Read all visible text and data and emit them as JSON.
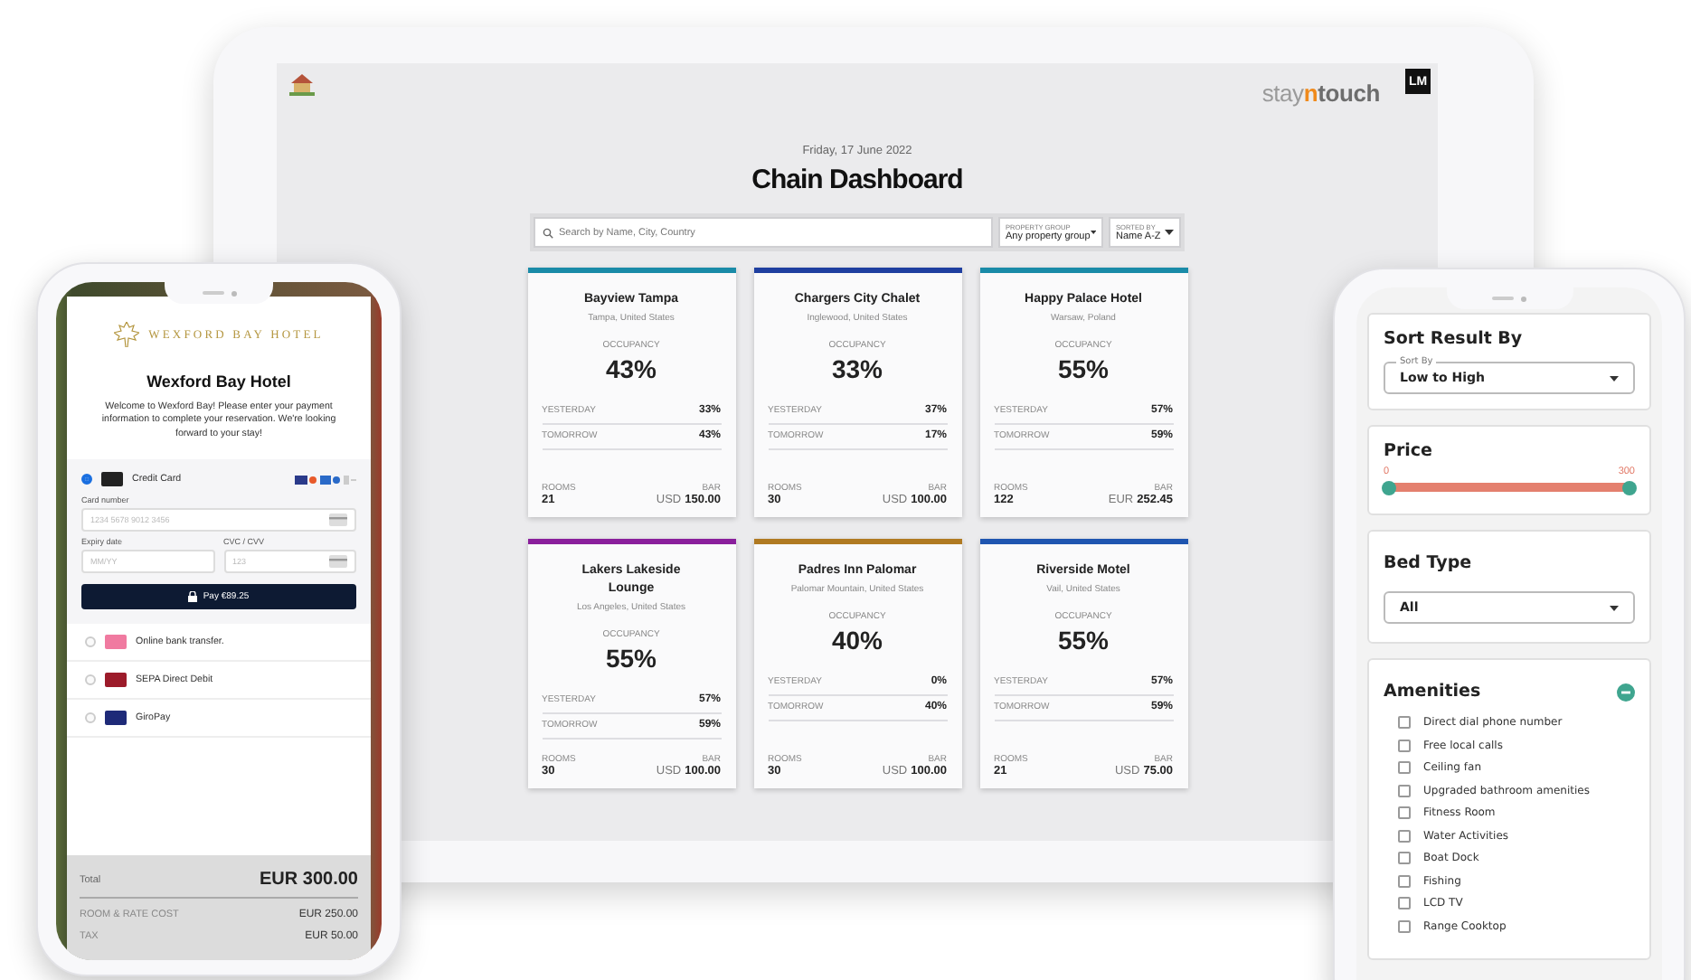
{
  "tablet": {
    "brand": [
      {
        "text": "stay",
        "kind": "light"
      },
      {
        "text": "n",
        "kind": "accent"
      },
      {
        "text": "touch",
        "kind": "bold"
      }
    ],
    "user_badge": "LM",
    "date": "Friday, 17 June 2022",
    "title": "Chain Dashboard",
    "search": {
      "placeholder": "Search by Name, City, Country"
    },
    "filters": [
      {
        "label": "PROPERTY GROUP",
        "value": "Any property group"
      },
      {
        "label": "SORTED BY",
        "value": "Name A-Z"
      }
    ],
    "cards": [
      {
        "name": "Bayview Tampa",
        "location": "Tampa, United States",
        "color": "#1a8ba8",
        "occupancy_label": "OCCUPANCY",
        "occupancy": "43%",
        "rows": [
          {
            "label": "YESTERDAY",
            "value": "33%"
          },
          {
            "label": "TOMORROW",
            "value": "43%"
          }
        ],
        "rooms_label": "ROOMS",
        "rooms": "21",
        "bar_label": "BAR",
        "currency": "USD",
        "bar": "150.00"
      },
      {
        "name": "Chargers City Chalet",
        "location": "Inglewood, United States",
        "color": "#1f3fa0",
        "occupancy_label": "OCCUPANCY",
        "occupancy": "33%",
        "rows": [
          {
            "label": "YESTERDAY",
            "value": "37%"
          },
          {
            "label": "TOMORROW",
            "value": "17%"
          }
        ],
        "rooms_label": "ROOMS",
        "rooms": "30",
        "bar_label": "BAR",
        "currency": "USD",
        "bar": "100.00"
      },
      {
        "name": "Happy Palace Hotel",
        "location": "Warsaw, Poland",
        "color": "#1a8ba8",
        "occupancy_label": "OCCUPANCY",
        "occupancy": "55%",
        "rows": [
          {
            "label": "YESTERDAY",
            "value": "57%"
          },
          {
            "label": "TOMORROW",
            "value": "59%"
          }
        ],
        "rooms_label": "ROOMS",
        "rooms": "122",
        "bar_label": "BAR",
        "currency": "EUR",
        "bar": "252.45"
      },
      {
        "name": "Lakers Lakeside Lounge",
        "location": "Los Angeles, United States",
        "color": "#8a1f9c",
        "occupancy_label": "OCCUPANCY",
        "occupancy": "55%",
        "rows": [
          {
            "label": "YESTERDAY",
            "value": "57%"
          },
          {
            "label": "TOMORROW",
            "value": "59%"
          }
        ],
        "rooms_label": "ROOMS",
        "rooms": "30",
        "bar_label": "BAR",
        "currency": "USD",
        "bar": "100.00"
      },
      {
        "name": "Padres Inn Palomar",
        "location": "Palomar Mountain, United States",
        "color": "#b07a22",
        "occupancy_label": "OCCUPANCY",
        "occupancy": "40%",
        "rows": [
          {
            "label": "YESTERDAY",
            "value": "0%"
          },
          {
            "label": "TOMORROW",
            "value": "40%"
          }
        ],
        "rooms_label": "ROOMS",
        "rooms": "30",
        "bar_label": "BAR",
        "currency": "USD",
        "bar": "100.00"
      },
      {
        "name": "Riverside Motel",
        "location": "Vail, United States",
        "color": "#1f55b0",
        "occupancy_label": "OCCUPANCY",
        "occupancy": "55%",
        "rows": [
          {
            "label": "YESTERDAY",
            "value": "57%"
          },
          {
            "label": "TOMORROW",
            "value": "59%"
          }
        ],
        "rooms_label": "ROOMS",
        "rooms": "21",
        "bar_label": "BAR",
        "currency": "USD",
        "bar": "75.00"
      }
    ]
  },
  "payment_phone": {
    "logo_text": "WEXFORD BAY HOTEL",
    "title": "Wexford Bay Hotel",
    "message": "Welcome to Wexford Bay! Please enter your payment information to complete your reservation. We're looking forward to your stay!",
    "card_form": {
      "card_number": {
        "label": "Card number",
        "placeholder": "1234 5678 9012 3456"
      },
      "expiry": {
        "label": "Expiry date",
        "placeholder": "MM/YY"
      },
      "cvc": {
        "label": "CVC / CVV",
        "placeholder": "123"
      },
      "pay_button": "Pay €89.25"
    },
    "methods": [
      {
        "label": "Credit Card",
        "selected": true,
        "color": "#222222"
      },
      {
        "label": "Online bank transfer.",
        "selected": false,
        "color": "#f07aa0"
      },
      {
        "label": "SEPA Direct Debit",
        "selected": false,
        "color": "#9c1b2a"
      },
      {
        "label": "GiroPay",
        "selected": false,
        "color": "#1e2a78"
      }
    ],
    "total": {
      "label": "Total",
      "value": "EUR 300.00"
    },
    "lines": [
      {
        "label": "ROOM & RATE COST",
        "value": "EUR 250.00"
      },
      {
        "label": "TAX",
        "value": "EUR 50.00"
      }
    ]
  },
  "filter_phone": {
    "sort": {
      "title": "Sort Result By",
      "field_label": "Sort By",
      "value": "Low to High"
    },
    "price": {
      "title": "Price",
      "min": "0",
      "max": "300",
      "level": 1
    },
    "bed_type": {
      "title": "Bed Type",
      "value": "All"
    },
    "amenities": {
      "title": "Amenities",
      "expanded": true,
      "items": [
        {
          "label": "Direct dial phone number",
          "checked": false
        },
        {
          "label": "Free local calls",
          "checked": false
        },
        {
          "label": "Ceiling fan",
          "checked": false
        },
        {
          "label": "Upgraded bathroom amenities",
          "checked": false
        },
        {
          "label": "Fitness Room",
          "checked": false
        },
        {
          "label": "Water Activities",
          "checked": false
        },
        {
          "label": "Boat Dock",
          "checked": false
        },
        {
          "label": "Fishing",
          "checked": false
        },
        {
          "label": "LCD TV",
          "checked": false
        },
        {
          "label": "Range Cooktop",
          "checked": false
        }
      ]
    }
  }
}
